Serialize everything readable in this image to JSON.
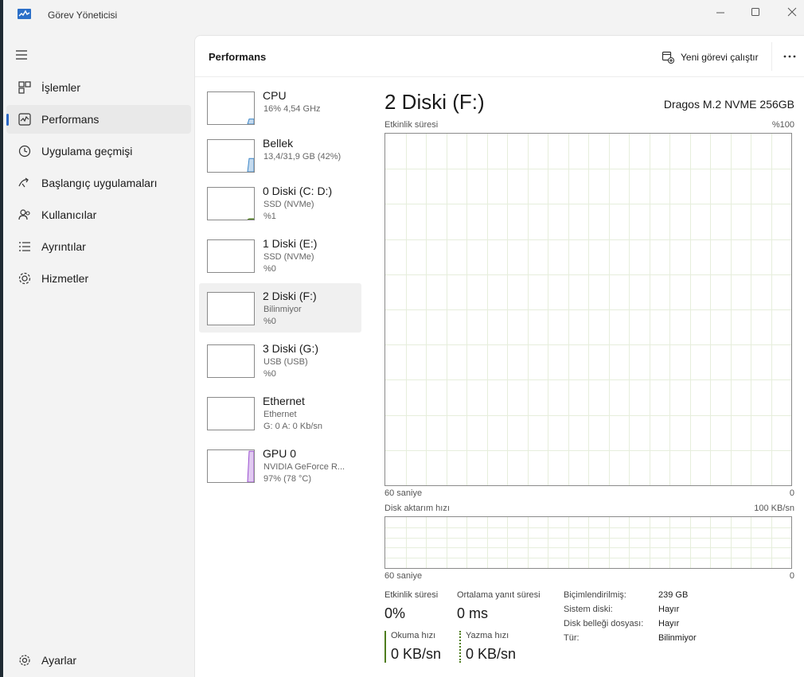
{
  "window": {
    "title": "Görev Yöneticisi"
  },
  "nav": {
    "items": [
      {
        "label": "İşlemler",
        "icon": "processes-icon"
      },
      {
        "label": "Performans",
        "icon": "performance-icon",
        "active": true
      },
      {
        "label": "Uygulama geçmişi",
        "icon": "history-icon"
      },
      {
        "label": "Başlangıç uygulamaları",
        "icon": "startup-icon"
      },
      {
        "label": "Kullanıcılar",
        "icon": "users-icon"
      },
      {
        "label": "Ayrıntılar",
        "icon": "details-icon"
      },
      {
        "label": "Hizmetler",
        "icon": "services-icon"
      }
    ],
    "settings_label": "Ayarlar"
  },
  "header": {
    "title": "Performans",
    "run_task_label": "Yeni görevi çalıştır"
  },
  "devices": [
    {
      "name": "CPU",
      "line1": "16% 4,54 GHz",
      "line2": "",
      "color": "#3c86c8",
      "fill": 0.16
    },
    {
      "name": "Bellek",
      "line1": "13,4/31,9 GB (42%)",
      "line2": "",
      "color": "#3c86c8",
      "fill": 0.42
    },
    {
      "name": "0 Diski (C: D:)",
      "line1": "SSD (NVMe)",
      "line2": "%1",
      "color": "#4e7d1e",
      "fill": 0.01
    },
    {
      "name": "1 Diski (E:)",
      "line1": "SSD (NVMe)",
      "line2": "%0",
      "color": "#4e7d1e",
      "fill": 0
    },
    {
      "name": "2 Diski (F:)",
      "line1": "Bilinmiyor",
      "line2": "%0",
      "color": "#4e7d1e",
      "fill": 0,
      "active": true
    },
    {
      "name": "3 Diski (G:)",
      "line1": "USB (USB)",
      "line2": "%0",
      "color": "#4e7d1e",
      "fill": 0
    },
    {
      "name": "Ethernet",
      "line1": "Ethernet",
      "line2": "G: 0 A: 0 Kb/sn",
      "color": "#a86b2b",
      "fill": 0
    },
    {
      "name": "GPU 0",
      "line1": "NVIDIA GeForce R...",
      "line2": "97% (78 °C)",
      "color": "#9a4fd0",
      "fill": 0.97
    }
  ],
  "detail": {
    "title": "2 Diski (F:)",
    "model": "Dragos M.2 NVME 256GB",
    "activity_graph": {
      "label": "Etkinlik süresi",
      "max": "%100",
      "time_left": "60 saniye",
      "time_right": "0"
    },
    "transfer_graph": {
      "label": "Disk aktarım hızı",
      "max": "100 KB/sn",
      "time_left": "60 saniye",
      "time_right": "0"
    },
    "stats": {
      "activity_label": "Etkinlik süresi",
      "activity_value": "0%",
      "response_label": "Ortalama yanıt süresi",
      "response_value": "0 ms",
      "read_label": "Okuma hızı",
      "read_value": "0 KB/sn",
      "write_label": "Yazma hızı",
      "write_value": "0 KB/sn"
    },
    "properties": [
      {
        "key": "Biçimlendirilmiş:",
        "value": "239 GB"
      },
      {
        "key": "Sistem diski:",
        "value": "Hayır"
      },
      {
        "key": "Disk belleği dosyası:",
        "value": "Hayır"
      },
      {
        "key": "Tür:",
        "value": "Bilinmiyor"
      }
    ]
  },
  "colors": {
    "accent": "#2a66c4",
    "disk_green": "#4e7d1e",
    "grid": "#e6eedc"
  }
}
